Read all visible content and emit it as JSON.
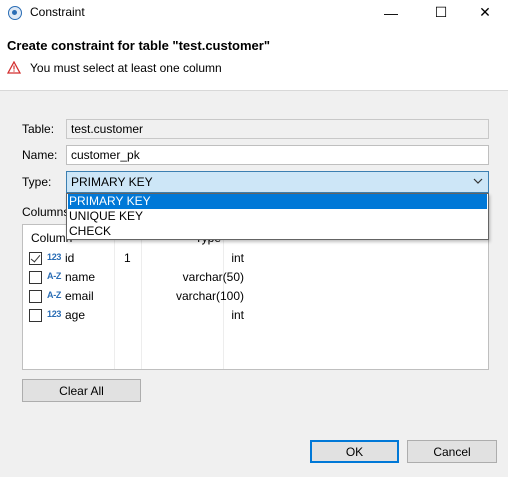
{
  "window": {
    "title": "Constraint",
    "minimize": "—",
    "maximize": "☐",
    "close": "✕"
  },
  "header": {
    "title": "Create constraint for table \"test.customer\"",
    "message": "You must select at least one column"
  },
  "form": {
    "table_label": "Table:",
    "table_value": "test.customer",
    "name_label": "Name:",
    "name_value": "customer_pk",
    "type_label": "Type:",
    "type_value": "PRIMARY KEY",
    "columns_label": "Columns"
  },
  "type_options": [
    "PRIMARY KEY",
    "UNIQUE KEY",
    "CHECK"
  ],
  "columns_table": {
    "headers": {
      "column": "Column",
      "position": "",
      "type": "Type"
    },
    "rows": [
      {
        "checked": true,
        "icon": "123",
        "name": "id",
        "position": "1",
        "type": "int"
      },
      {
        "checked": false,
        "icon": "A-Z",
        "name": "name",
        "position": "",
        "type": "varchar(50)"
      },
      {
        "checked": false,
        "icon": "A-Z",
        "name": "email",
        "position": "",
        "type": "varchar(100)"
      },
      {
        "checked": false,
        "icon": "123",
        "name": "age",
        "position": "",
        "type": "int"
      }
    ]
  },
  "buttons": {
    "clear_all": "Clear All",
    "ok": "OK",
    "cancel": "Cancel"
  },
  "colors": {
    "accent": "#0078d7",
    "warning": "#d32f2f",
    "icon_blue": "#2a6db5"
  }
}
